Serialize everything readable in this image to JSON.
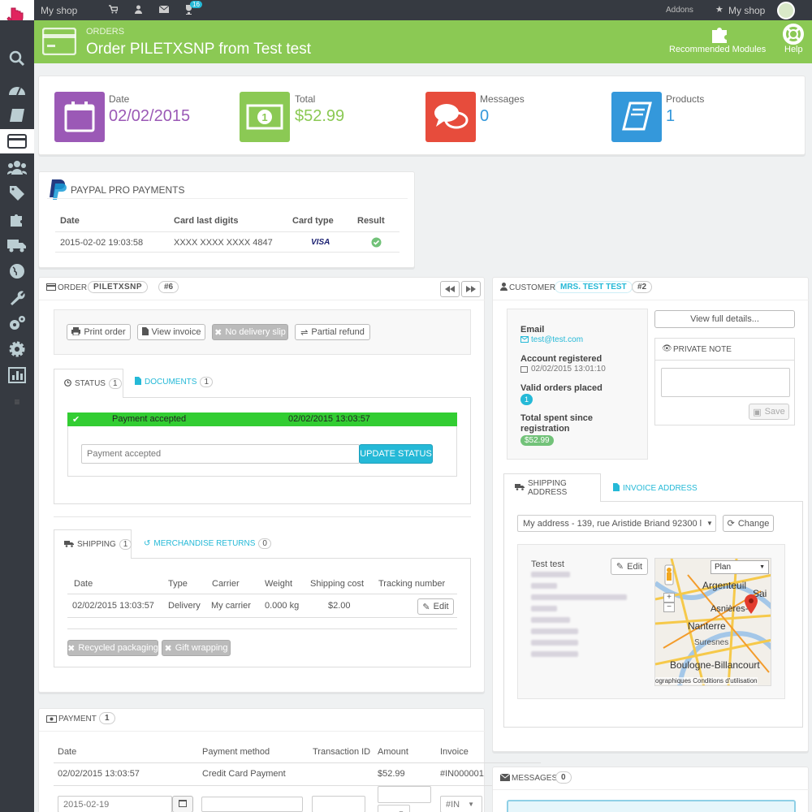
{
  "topbar": {
    "shop_name": "My shop",
    "notification_count": "16",
    "addons": "Addons",
    "my_shop": "My shop"
  },
  "header": {
    "breadcrumb": "ORDERS",
    "title": "Order PILETXSNP from Test test",
    "recommended_modules": "Recommended Modules",
    "help": "Help"
  },
  "kpis": [
    {
      "label": "Date",
      "value": "02/02/2015",
      "color": "#9b59b6"
    },
    {
      "label": "Total",
      "value": "$52.99",
      "color": "#8bc954"
    },
    {
      "label": "Messages",
      "value": "0",
      "color": "#e74c3c"
    },
    {
      "label": "Products",
      "value": "1",
      "color": "#3498db"
    }
  ],
  "paypal": {
    "title": "PAYPAL PRO PAYMENTS",
    "headers": [
      "Date",
      "Card last digits",
      "Card type",
      "Result"
    ],
    "row": {
      "date": "2015-02-02 19:03:58",
      "card": "XXXX XXXX XXXX 4847",
      "type": "VISA"
    }
  },
  "order": {
    "label": "ORDER",
    "reference": "PILETXSNP",
    "number": "#6",
    "buttons": {
      "print": "Print order",
      "invoice": "View invoice",
      "no_delivery": "No delivery slip",
      "partial_refund": "Partial refund"
    },
    "tabs": {
      "status": "STATUS",
      "status_count": "1",
      "documents": "DOCUMENTS",
      "documents_count": "1"
    },
    "status_row": {
      "status": "Payment accepted",
      "date": "02/02/2015 13:03:57"
    },
    "status_select": "Payment accepted",
    "update_status": "UPDATE STATUS",
    "shipping_tabs": {
      "shipping": "SHIPPING",
      "shipping_count": "1",
      "returns": "MERCHANDISE RETURNS",
      "returns_count": "0"
    },
    "shipping_headers": [
      "Date",
      "Type",
      "Carrier",
      "Weight",
      "Shipping cost",
      "Tracking number"
    ],
    "shipping_row": {
      "date": "02/02/2015 13:03:57",
      "type": "Delivery",
      "carrier": "My carrier",
      "weight": "0.000 kg",
      "cost": "$2.00",
      "edit": "Edit"
    },
    "recycled": "Recycled packaging",
    "gift": "Gift wrapping"
  },
  "payment": {
    "label": "PAYMENT",
    "count": "1",
    "headers": [
      "Date",
      "Payment method",
      "Transaction ID",
      "Amount",
      "Invoice"
    ],
    "row": {
      "date": "02/02/2015 13:03:57",
      "method": "Credit Card Payment",
      "amount": "$52.99",
      "invoice": "#IN000001"
    },
    "new_date": "2015-02-19",
    "invoice_select": "#IN"
  },
  "customer": {
    "label": "CUSTOMER",
    "name": "MRS. TEST TEST",
    "number": "#2",
    "email_label": "Email",
    "email": "test@test.com",
    "registered_label": "Account registered",
    "registered": "02/02/2015 13:01:10",
    "valid_orders_label": "Valid orders placed",
    "valid_orders": "1",
    "total_spent_label": "Total spent since registration",
    "total_spent": "$52.99",
    "view_details": "View full details...",
    "private_note": "PRIVATE NOTE",
    "save": "Save"
  },
  "address": {
    "shipping_tab": "SHIPPING ADDRESS",
    "invoice_tab": "INVOICE ADDRESS",
    "select": "My address - 139, rue Aristide Briand 92300 l",
    "change": "Change",
    "name": "Test test",
    "edit": "Edit",
    "map_type": "Plan",
    "map_cities": [
      "Argenteuil",
      "Asnières-s",
      "Nanterre",
      "Suresnes",
      "Boulogne-Billancourt",
      "Sai"
    ],
    "map_credit": "ographiques   Conditions d'utilisation"
  },
  "messages": {
    "label": "MESSAGES",
    "count": "0"
  }
}
